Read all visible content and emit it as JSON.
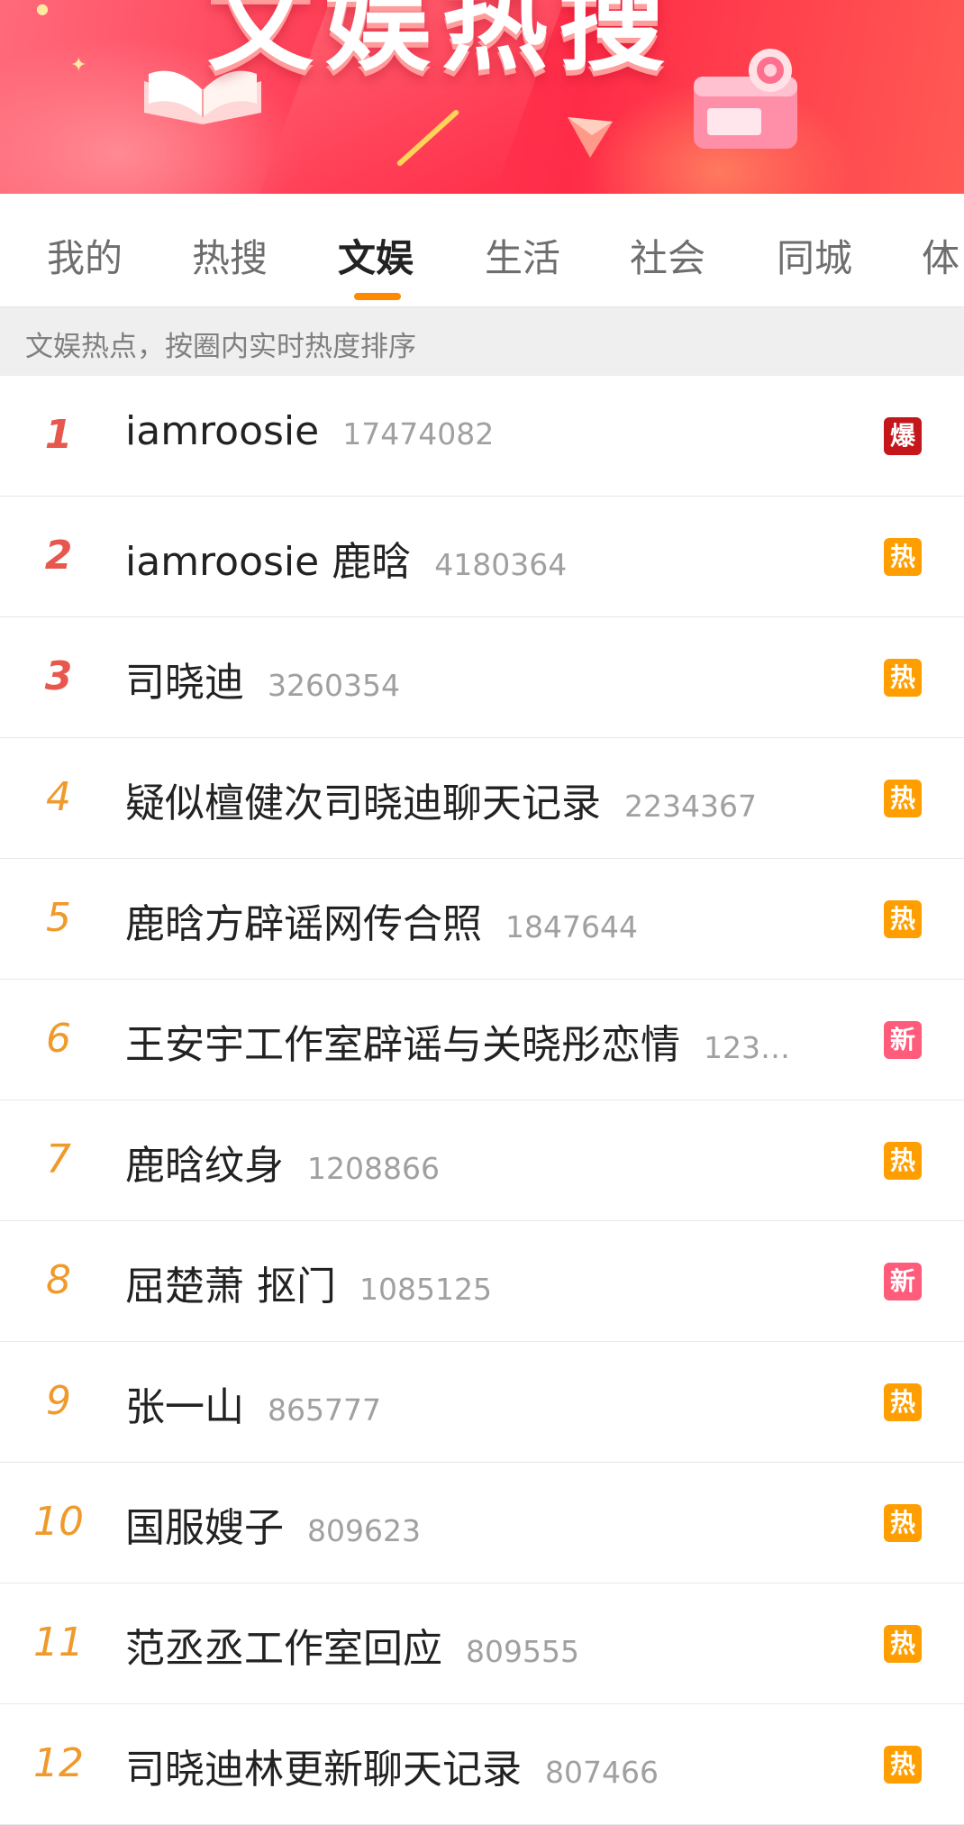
{
  "banner": {
    "title": "文娱热搜",
    "colors": {
      "bg_start": "#ff6a7a",
      "bg_end": "#ff2c48"
    }
  },
  "tabs": [
    {
      "label": "我的",
      "active": false
    },
    {
      "label": "热搜",
      "active": false
    },
    {
      "label": "文娱",
      "active": true
    },
    {
      "label": "生活",
      "active": false
    },
    {
      "label": "社会",
      "active": false
    },
    {
      "label": "同城",
      "active": false
    },
    {
      "label": "体",
      "active": false
    }
  ],
  "notice": "文娱热点，按圈内实时热度排序",
  "colors": {
    "accent": "#ff8a00",
    "rank_top": "#e8574e",
    "rank_other": "#ef9a2b",
    "badge_explode": "#c5161c",
    "badge_hot": "#ff9e00",
    "badge_new": "#ff5b7a"
  },
  "items": [
    {
      "rank": "1",
      "title": "iamroosie",
      "count": "17474082",
      "badge": "爆",
      "badge_type": "explode"
    },
    {
      "rank": "2",
      "title": "iamroosie 鹿晗",
      "count": "4180364",
      "badge": "热",
      "badge_type": "hot"
    },
    {
      "rank": "3",
      "title": "司晓迪",
      "count": "3260354",
      "badge": "热",
      "badge_type": "hot"
    },
    {
      "rank": "4",
      "title": "疑似檀健次司晓迪聊天记录",
      "count": "2234367",
      "badge": "热",
      "badge_type": "hot"
    },
    {
      "rank": "5",
      "title": "鹿晗方辟谣网传合照",
      "count": "1847644",
      "badge": "热",
      "badge_type": "hot"
    },
    {
      "rank": "6",
      "title": "王安宇工作室辟谣与关晓彤恋情",
      "count": "123…",
      "badge": "新",
      "badge_type": "new"
    },
    {
      "rank": "7",
      "title": "鹿晗纹身",
      "count": "1208866",
      "badge": "热",
      "badge_type": "hot"
    },
    {
      "rank": "8",
      "title": "屈楚萧 抠门",
      "count": "1085125",
      "badge": "新",
      "badge_type": "new"
    },
    {
      "rank": "9",
      "title": "张一山",
      "count": "865777",
      "badge": "热",
      "badge_type": "hot"
    },
    {
      "rank": "10",
      "title": "国服嫂子",
      "count": "809623",
      "badge": "热",
      "badge_type": "hot"
    },
    {
      "rank": "11",
      "title": "范丞丞工作室回应",
      "count": "809555",
      "badge": "热",
      "badge_type": "hot"
    },
    {
      "rank": "12",
      "title": "司晓迪林更新聊天记录",
      "count": "807466",
      "badge": "热",
      "badge_type": "hot"
    }
  ]
}
